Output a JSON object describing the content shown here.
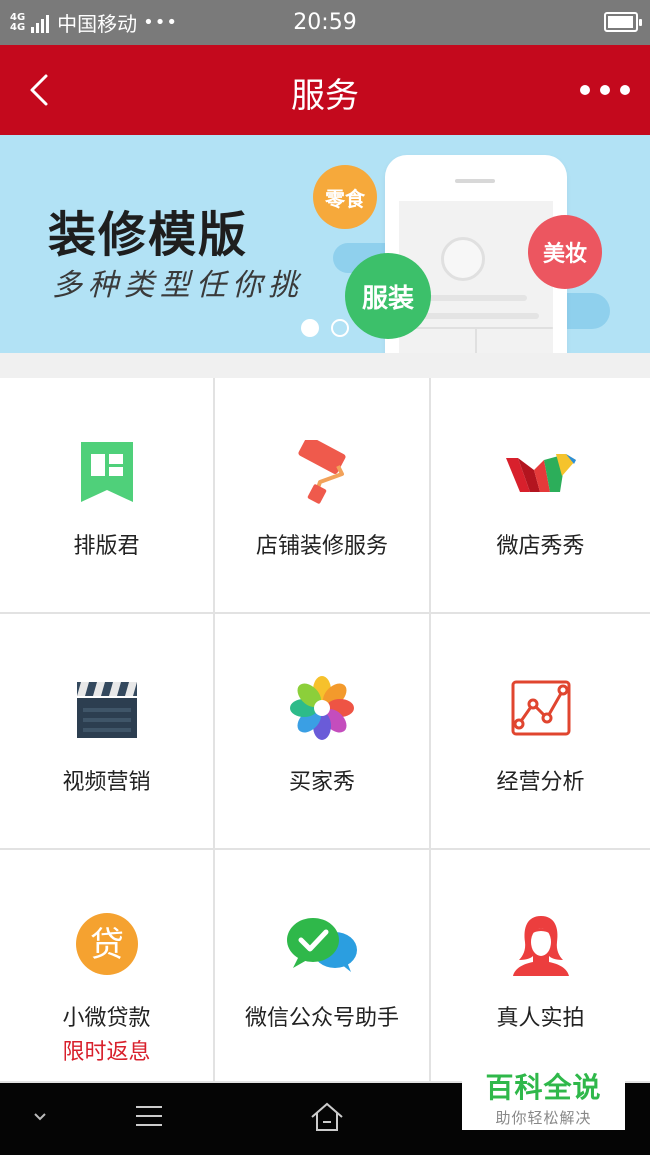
{
  "status_bar": {
    "network_1": "4G",
    "network_2": "4G",
    "carrier": "中国移动",
    "more": "•••",
    "time": "20:59",
    "battery_level": 0.95
  },
  "header": {
    "title": "服务",
    "back_icon": "chevron-left-icon",
    "more_icon": "more-dots-icon"
  },
  "banner": {
    "title": "装修模版",
    "subtitle": "多种类型任你挑",
    "tags": [
      "零食",
      "服装",
      "美妆"
    ],
    "page_count": 2,
    "active_page": 1
  },
  "services": [
    {
      "label": "排版君",
      "icon": "layout-flag-icon"
    },
    {
      "label": "店铺装修服务",
      "icon": "paint-roller-icon"
    },
    {
      "label": "微店秀秀",
      "icon": "colorful-w-icon"
    },
    {
      "label": "视频营销",
      "icon": "clapperboard-icon"
    },
    {
      "label": "买家秀",
      "icon": "pinwheel-icon"
    },
    {
      "label": "经营分析",
      "icon": "line-chart-icon"
    },
    {
      "label": "小微贷款",
      "sub": "限时返息",
      "icon": "loan-coin-icon"
    },
    {
      "label": "微信公众号助手",
      "icon": "wechat-bubbles-icon"
    },
    {
      "label": "真人实拍",
      "icon": "person-silhouette-icon"
    }
  ],
  "nav": {
    "icons": [
      "chevron-down-icon",
      "menu-icon",
      "home-icon"
    ]
  },
  "watermark": {
    "title": "百科全说",
    "subtitle": "助你轻松解决"
  },
  "colors": {
    "header": "#c4091d",
    "status_bar": "#7a7a7a",
    "banner": "#b2e2f5",
    "accent_red": "#d8202c",
    "watermark_green": "#2fb84a"
  }
}
